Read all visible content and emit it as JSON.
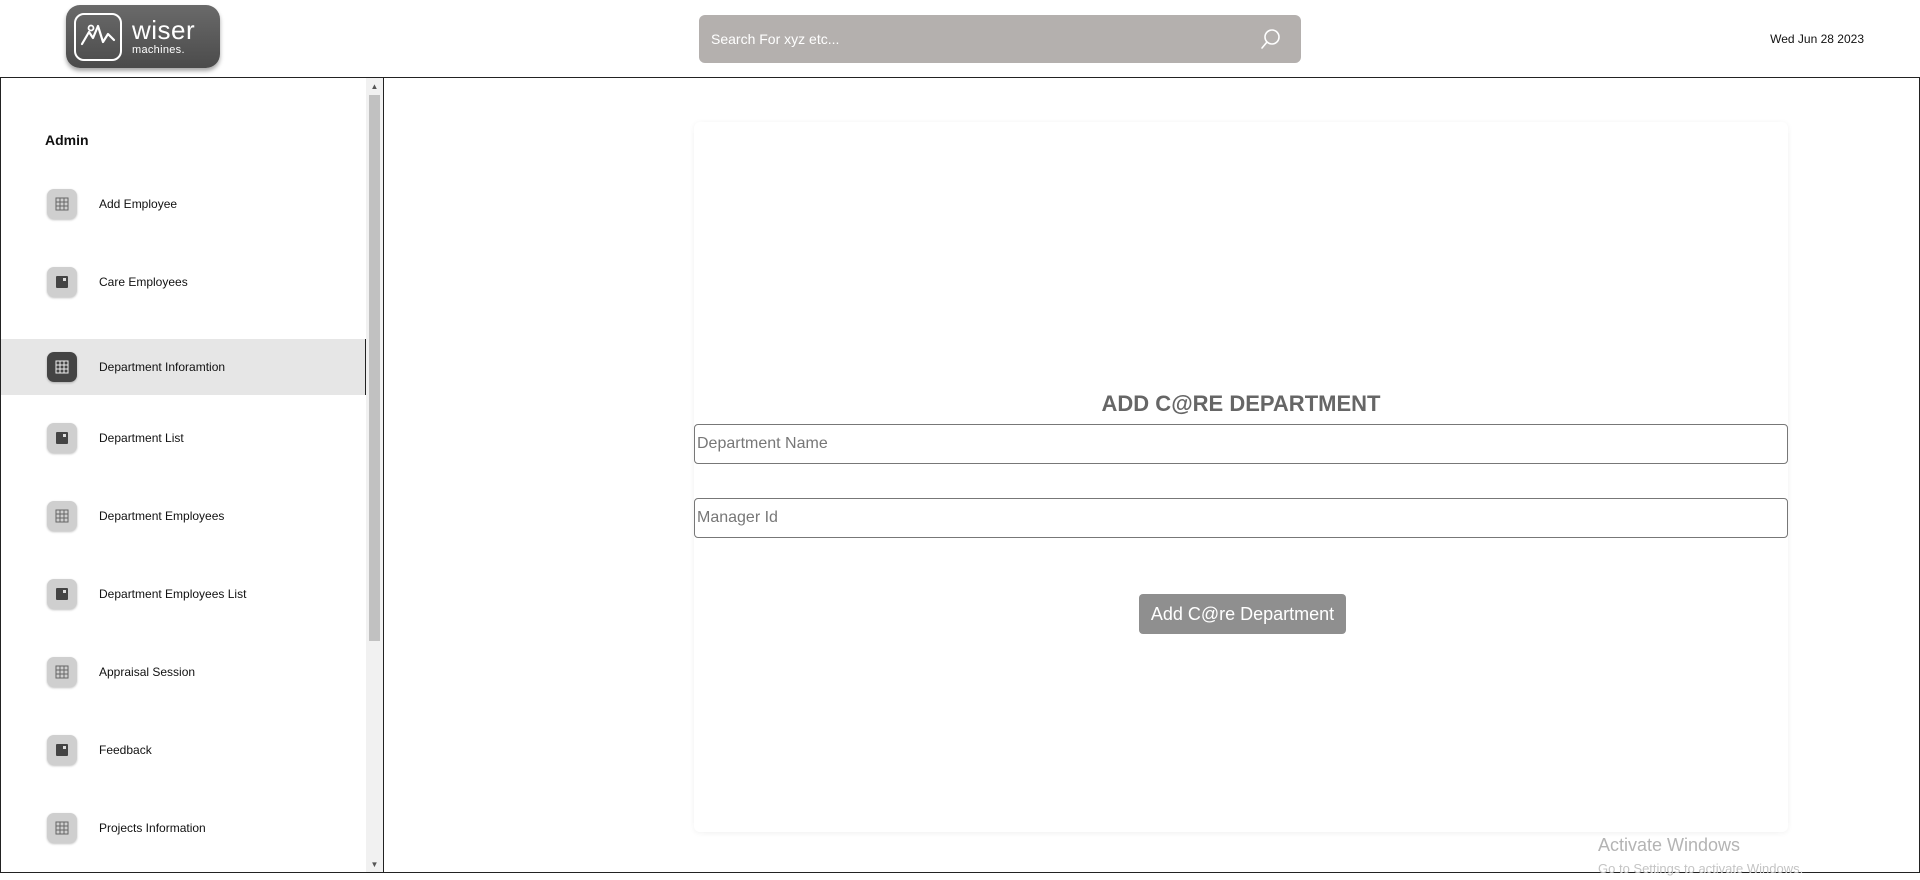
{
  "header": {
    "logo_word": "wiser",
    "logo_sub": "machines.",
    "search_placeholder": "Search For xyz etc...",
    "date": "Wed Jun 28 2023"
  },
  "sidebar": {
    "section_title": "Admin",
    "items": [
      {
        "label": "Add Employee",
        "icon": "grid-icon"
      },
      {
        "label": "Care Employees",
        "icon": "square-icon"
      },
      {
        "label": "Department Inforamtion",
        "icon": "grid-icon"
      },
      {
        "label": "Department List",
        "icon": "square-icon"
      },
      {
        "label": "Department Employees",
        "icon": "grid-icon"
      },
      {
        "label": "Department Employees List",
        "icon": "square-icon"
      },
      {
        "label": "Appraisal Session",
        "icon": "grid-icon"
      },
      {
        "label": "Feedback",
        "icon": "square-icon"
      },
      {
        "label": "Projects Information",
        "icon": "grid-icon"
      }
    ],
    "active_item": "Department Inforamtion"
  },
  "form": {
    "title": "ADD C@RE DEPARTMENT",
    "department_name_placeholder": "Department Name",
    "manager_id_placeholder": "Manager Id",
    "submit_label": "Add C@re Department"
  },
  "watermark": {
    "title": "Activate Windows",
    "subtitle": "Go to Settings to activate Windows."
  },
  "colors": {
    "search_bg": "#b4b0ae",
    "button_bg": "#8f8f8f",
    "active_item_bg": "#e6e6e6",
    "title_color": "#666666"
  }
}
